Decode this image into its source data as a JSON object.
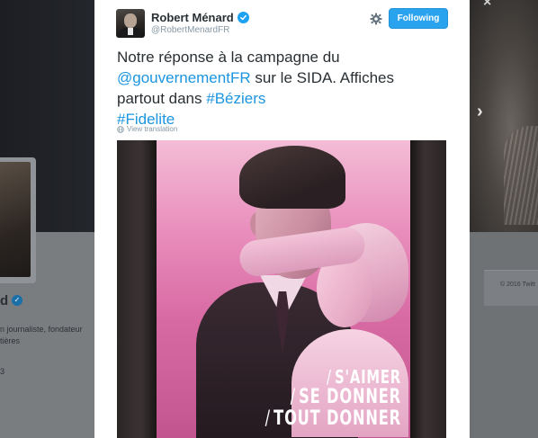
{
  "background_profile": {
    "name_fragment": "d",
    "bio_lines": [
      "n journaliste, fondateur",
      "tières"
    ],
    "count_fragment": "3",
    "copyright": "© 2016 Twitt"
  },
  "tweet": {
    "display_name": "Robert Ménard",
    "username": "@RobertMenardFR",
    "follow_button_label": "Following",
    "text_segments": {
      "line1": "Notre réponse à la campagne du",
      "mention": "@gouvernementFR",
      "line2_rest": " sur le SIDA. Affiches",
      "line3_prefix": "partout dans ",
      "hashtag_beziers": "#Béziers",
      "hashtag_fidelite": "#Fidelite"
    },
    "translate_label": "View translation"
  },
  "photo": {
    "poster_lines": [
      "S'AIMER",
      "SE DONNER",
      "TOUT DONNER"
    ],
    "slash": "/"
  },
  "colors": {
    "accent": "#1da1f2",
    "link": "#1b95e0",
    "follow_button": "#2aa3ef",
    "poster_pink": "#d86aa3"
  },
  "icons": {
    "verified": "verified-badge-icon",
    "settings": "gear-icon",
    "translate": "globe-icon",
    "next": "chevron-right-icon"
  }
}
